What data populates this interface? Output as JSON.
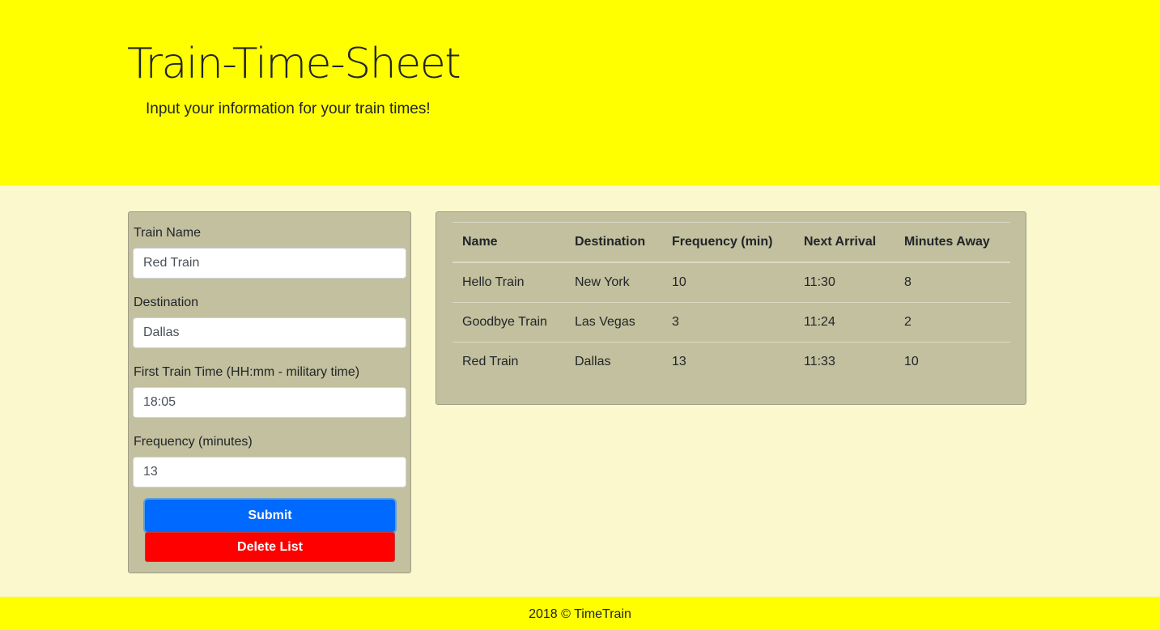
{
  "header": {
    "title": "Train-Time-Sheet",
    "subtitle": "Input your information for your train times!"
  },
  "form": {
    "train_name_label": "Train Name",
    "train_name_value": "Red Train",
    "destination_label": "Destination",
    "destination_value": "Dallas",
    "first_time_label": "First Train Time (HH:mm - military time)",
    "first_time_value": "18:05",
    "frequency_label": "Frequency (minutes)",
    "frequency_value": "13",
    "submit_label": "Submit",
    "delete_label": "Delete List"
  },
  "table": {
    "headers": [
      "Name",
      "Destination",
      "Frequency (min)",
      "Next Arrival",
      "Minutes Away"
    ],
    "rows": [
      [
        "Hello Train",
        "New York",
        "10",
        "11:30",
        "8"
      ],
      [
        "Goodbye Train",
        "Las Vegas",
        "3",
        "11:24",
        "2"
      ],
      [
        "Red Train",
        "Dallas",
        "13",
        "11:33",
        "10"
      ]
    ]
  },
  "footer": {
    "text": "2018 © TimeTrain"
  },
  "colors": {
    "header_bg": "#ffff00",
    "page_bg": "#faf8cc",
    "panel_bg": "#c2c09e",
    "submit_bg": "#0069ff",
    "delete_bg": "#ff0000"
  }
}
